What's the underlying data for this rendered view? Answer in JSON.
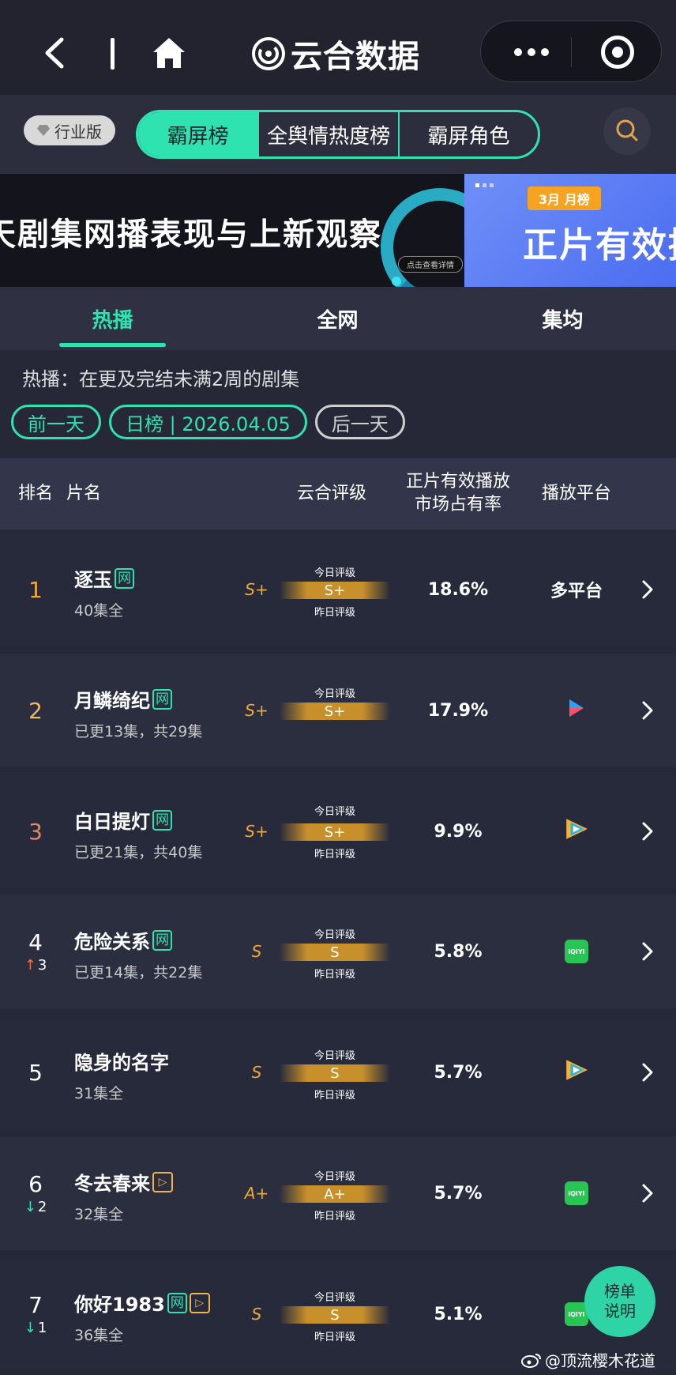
{
  "app": {
    "title": "云合数据"
  },
  "header": {
    "edition": "行业版",
    "tabs": [
      "霸屏榜",
      "全舆情热度榜",
      "霸屏角色"
    ]
  },
  "banner": {
    "left_text": "天剧集网播表现与上新观察",
    "left_cta": "点击查看详情",
    "right_tag": "3月 月榜",
    "right_text": "正片有效播"
  },
  "subtabs": [
    "热播",
    "全网",
    "集均"
  ],
  "note": "热播：在更及完结未满2周的剧集",
  "date_nav": {
    "prev": "前一天",
    "current": "日榜 | 2026.04.05",
    "next": "后一天"
  },
  "table": {
    "headers": {
      "rank": "排名",
      "title": "片名",
      "grade": "云合评级",
      "share": "正片有效播放\n市场占有率",
      "platform": "播放平台"
    },
    "today_label": "今日评级",
    "yesterday_label": "昨日评级",
    "rows": [
      {
        "rank": "1",
        "title": "逐玉",
        "net": "网",
        "vip": "",
        "episodes": "40集全",
        "grade": "S+",
        "bar": "S+",
        "share": "18.6%",
        "platform": "多平台",
        "platform_icon": "",
        "trend": "",
        "trend_val": ""
      },
      {
        "rank": "2",
        "title": "月鳞绮纪",
        "net": "网",
        "vip": "",
        "episodes": "已更13集，共29集",
        "grade": "S+",
        "bar": "S+",
        "share": "17.9%",
        "platform": "",
        "platform_icon": "youku-icon",
        "trend": "",
        "trend_val": ""
      },
      {
        "rank": "3",
        "title": "白日提灯",
        "net": "网",
        "vip": "",
        "episodes": "已更21集，共40集",
        "grade": "S+",
        "bar": "S+",
        "share": "9.9%",
        "platform": "",
        "platform_icon": "tencent-video-icon",
        "trend": "",
        "trend_val": ""
      },
      {
        "rank": "4",
        "title": "危险关系",
        "net": "网",
        "vip": "",
        "episodes": "已更14集，共22集",
        "grade": "S",
        "bar": "S",
        "share": "5.8%",
        "platform": "",
        "platform_icon": "iqiyi-icon",
        "trend": "up",
        "trend_val": "3"
      },
      {
        "rank": "5",
        "title": "隐身的名字",
        "net": "",
        "vip": "",
        "episodes": "31集全",
        "grade": "S",
        "bar": "S",
        "share": "5.7%",
        "platform": "",
        "platform_icon": "tencent-video-icon",
        "trend": "",
        "trend_val": ""
      },
      {
        "rank": "6",
        "title": "冬去春来",
        "net": "",
        "vip": "▷",
        "episodes": "32集全",
        "grade": "A+",
        "bar": "A+",
        "share": "5.7%",
        "platform": "",
        "platform_icon": "iqiyi-icon",
        "trend": "down",
        "trend_val": "2"
      },
      {
        "rank": "7",
        "title": "你好1983",
        "net": "网",
        "vip": "▷",
        "episodes": "36集全",
        "grade": "S",
        "bar": "S",
        "share": "5.1%",
        "platform": "",
        "platform_icon": "iqiyi-icon",
        "trend": "down",
        "trend_val": "1"
      }
    ]
  },
  "fab": {
    "line1": "榜单",
    "line2": "说明"
  },
  "credit": "@顶流樱木花道",
  "colors": {
    "accent": "#2fe3b0",
    "grade": "#f0a938",
    "background": "#262838"
  }
}
